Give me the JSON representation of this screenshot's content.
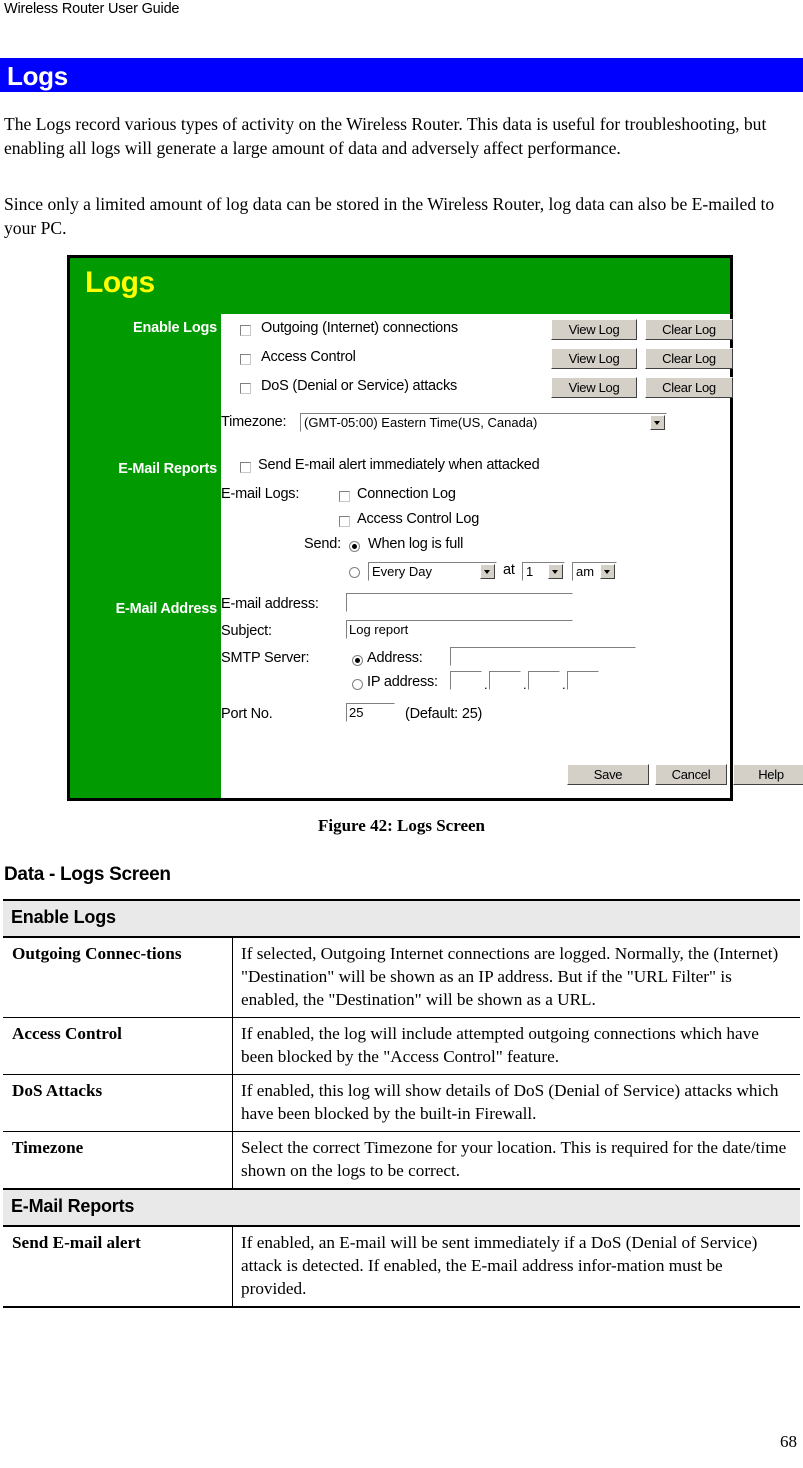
{
  "document": {
    "running_head": "Wireless Router User Guide",
    "page_number": "68",
    "chapter_title": "Logs",
    "paragraph_1": "The Logs record various types of activity on the Wireless Router. This data is useful for troubleshooting, but enabling all logs will generate a large amount of data and adversely affect performance.",
    "paragraph_2": "Since only a limited amount of log data can be stored in the Wireless Router, log data can also be E-mailed to your PC.",
    "figure_caption": "Figure 42: Logs Screen",
    "section_heading": "Data - Logs Screen"
  },
  "colors": {
    "banner_blue": "#0000FF",
    "panel_green": "#019A00",
    "panel_title_yellow": "#FFFF00",
    "table_group_gray": "#E9E9E9",
    "button_face": "#D4D0C8"
  },
  "screenshot": {
    "title": "Logs",
    "sidebar": {
      "enable_logs": "Enable Logs",
      "email_reports": "E-Mail Reports",
      "email_address": "E-Mail Address"
    },
    "enable_logs": {
      "rows": [
        {
          "label": "Outgoing (Internet) connections",
          "checked": false,
          "view": "View Log",
          "clear": "Clear Log"
        },
        {
          "label": "Access Control",
          "checked": false,
          "view": "View Log",
          "clear": "Clear Log"
        },
        {
          "label": "DoS (Denial or Service) attacks",
          "checked": false,
          "view": "View Log",
          "clear": "Clear Log"
        }
      ],
      "timezone_label": "Timezone:",
      "timezone_value": "(GMT-05:00) Eastern Time(US, Canada)"
    },
    "email_reports": {
      "send_alert_label": "Send E-mail alert immediately when attacked",
      "send_alert_checked": false,
      "email_logs_label": "E-mail Logs:",
      "connection_log_label": "Connection Log",
      "connection_log_checked": false,
      "access_control_log_label": "Access Control Log",
      "access_control_log_checked": false,
      "send_label": "Send:",
      "when_full_label": "When log is full",
      "when_full_selected": true,
      "schedule_selected": false,
      "schedule_value": "Every Day",
      "at_label": "at",
      "hour_value": "1",
      "ampm_value": "am"
    },
    "email_address": {
      "email_label": "E-mail address:",
      "email_value": "",
      "subject_label": "Subject:",
      "subject_value": "Log report",
      "smtp_label": "SMTP Server:",
      "address_radio_label": "Address:",
      "address_selected": true,
      "address_value": "",
      "ip_radio_label": "IP address:",
      "ip_selected": false,
      "ip_octets": [
        "",
        "",
        "",
        ""
      ],
      "port_label": "Port No.",
      "port_value": "25",
      "port_default_note": "(Default: 25)"
    },
    "buttons": {
      "save": "Save",
      "cancel": "Cancel",
      "help": "Help"
    }
  },
  "table": {
    "sections": [
      {
        "group": "Enable Logs",
        "rows": [
          {
            "key": "Outgoing Connec-tions",
            "value": "If selected, Outgoing Internet connections are logged. Normally, the (Internet) \"Destination\" will be shown as an IP address. But if the \"URL Filter\" is enabled, the \"Destination\" will be shown as a URL."
          },
          {
            "key": "Access Control",
            "value": "If enabled, the log will include attempted outgoing connections which have been blocked by the \"Access Control\" feature."
          },
          {
            "key": "DoS Attacks",
            "value": "If enabled, this log will show details of DoS (Denial of Service) attacks which have been blocked by the built-in Firewall."
          },
          {
            "key": "Timezone",
            "value": "Select the correct Timezone for your location. This is required for the date/time shown on the logs to be correct."
          }
        ]
      },
      {
        "group": "E-Mail Reports",
        "rows": [
          {
            "key": "Send E-mail alert",
            "value": "If enabled, an E-mail will be sent immediately if a DoS (Denial of Service) attack is detected. If enabled, the E-mail address infor-mation must be provided."
          }
        ]
      }
    ]
  }
}
